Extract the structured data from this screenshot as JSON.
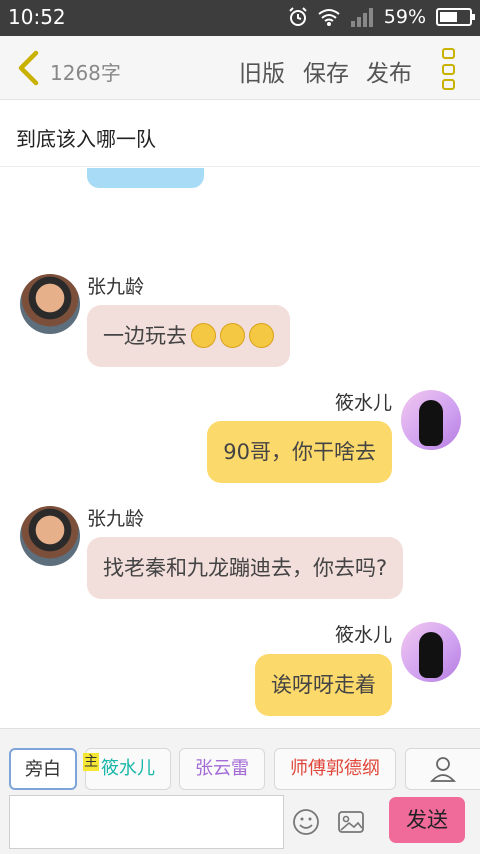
{
  "status": {
    "time": "10:52",
    "battery": "59%",
    "battery_level": 0.59
  },
  "topbar": {
    "word_count": "1268字",
    "old_version": "旧版",
    "save": "保存",
    "publish": "发布"
  },
  "story": {
    "title": "到底该入哪一队"
  },
  "messages": [
    {
      "speaker": "张九龄",
      "side": "left",
      "text": "一边玩去",
      "emoji_count": 3
    },
    {
      "speaker": "筱水儿",
      "side": "right",
      "text": "90哥，你干啥去"
    },
    {
      "speaker": "张九龄",
      "side": "left",
      "text": "找老秦和九龙蹦迪去，你去吗?"
    },
    {
      "speaker": "筱水儿",
      "side": "right",
      "text": "诶呀呀走着"
    }
  ],
  "roles": [
    {
      "label": "旁白",
      "color": "#333333"
    },
    {
      "label": "筱水儿",
      "color": "#19b7a8",
      "badge": "主"
    },
    {
      "label": "张云雷",
      "color": "#a36bd6"
    },
    {
      "label": "师傅郭德纲",
      "color": "#e0463a"
    }
  ],
  "composer": {
    "send_label": "发送"
  },
  "colors": {
    "left_bubble": "#f2dfdc",
    "right_bubble": "#fcd96b",
    "send_button": "#f06a9a",
    "accent_icon": "#c9b100"
  }
}
